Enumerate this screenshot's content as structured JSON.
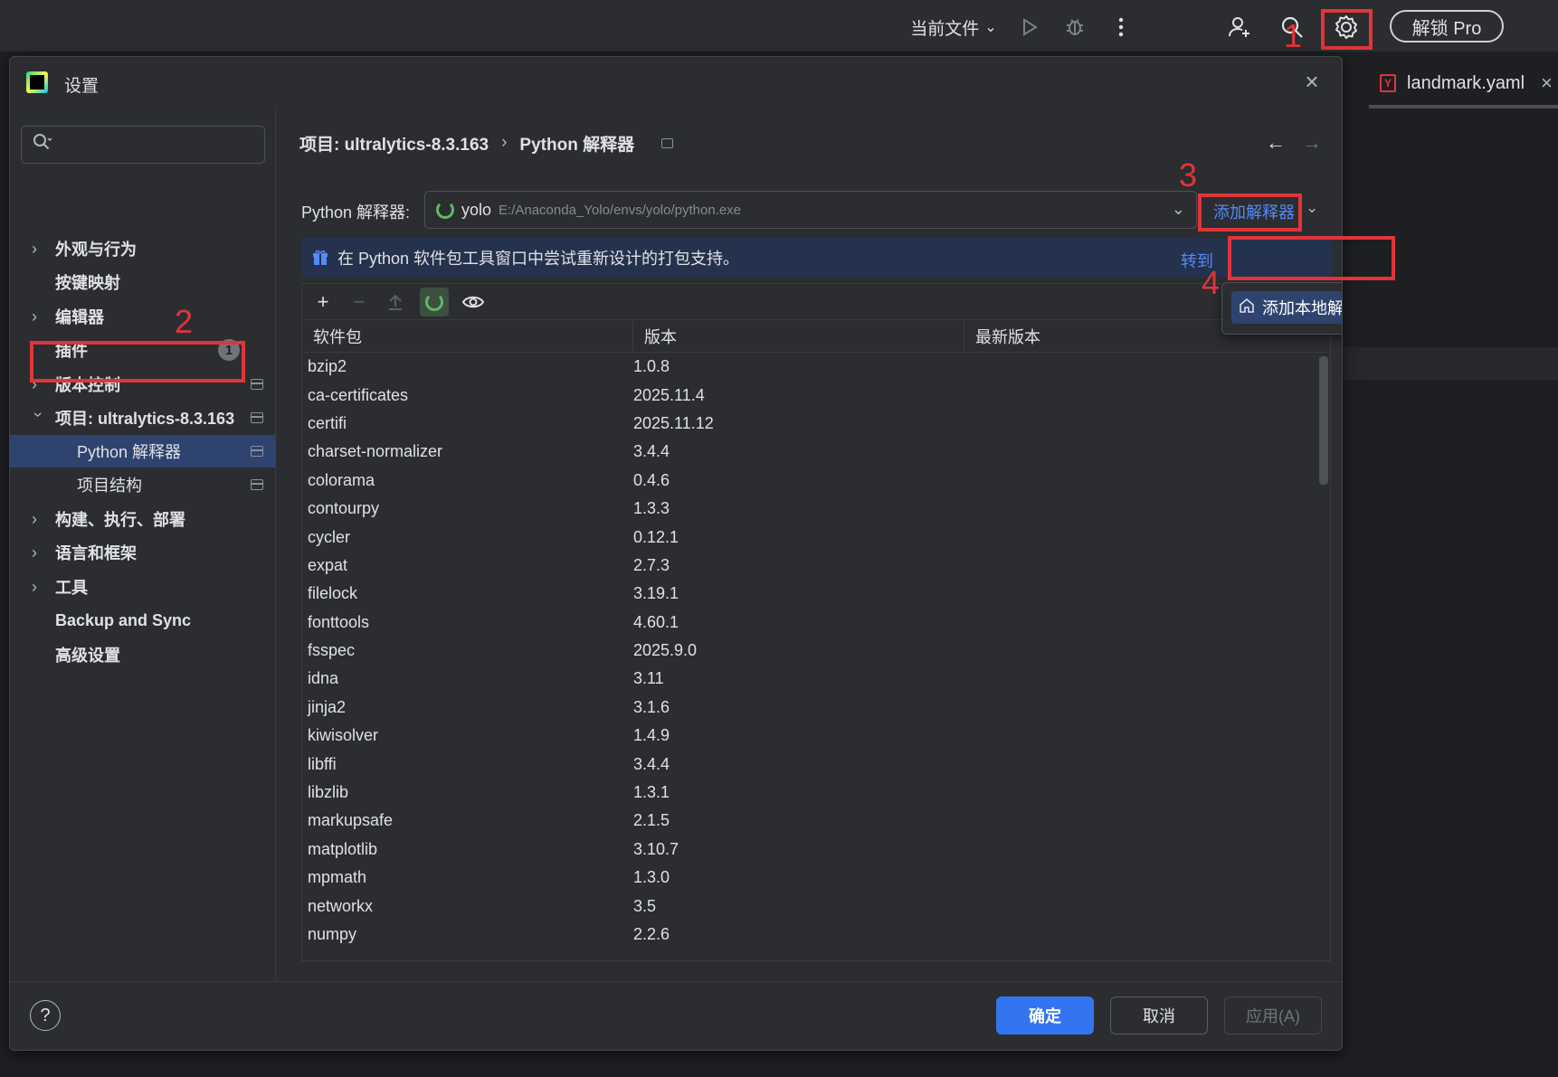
{
  "topbar": {
    "current_file_label": "当前文件",
    "pro_button_label": "解锁 Pro",
    "icons": [
      "run-icon",
      "debug-icon",
      "more-icon",
      "add-user-icon",
      "search-icon",
      "settings-icon"
    ]
  },
  "editor": {
    "tab_label": "landmark.yaml",
    "tab_icon_letter": "Y"
  },
  "annotations": [
    "1",
    "2",
    "3",
    "4"
  ],
  "dialog": {
    "title": "设置",
    "close_glyph": "×"
  },
  "sidebar": {
    "search_placeholder": "",
    "items": [
      {
        "label": "外观与行为",
        "expandable": true
      },
      {
        "label": "按键映射",
        "expandable": false
      },
      {
        "label": "编辑器",
        "expandable": true
      },
      {
        "label": "插件",
        "expandable": false,
        "badge": "1"
      },
      {
        "label": "版本控制",
        "expandable": true
      },
      {
        "label": "项目: ultralytics-8.3.163",
        "expandable": true,
        "expanded": true
      },
      {
        "label": "Python 解释器",
        "sub": true,
        "selected": true
      },
      {
        "label": "项目结构",
        "sub": true
      },
      {
        "label": "构建、执行、部署",
        "expandable": true
      },
      {
        "label": "语言和框架",
        "expandable": true
      },
      {
        "label": "工具",
        "expandable": true
      },
      {
        "label": "Backup and Sync",
        "expandable": false
      },
      {
        "label": "高级设置",
        "expandable": false
      }
    ]
  },
  "breadcrumb": {
    "project": "项目: ultralytics-8.3.163",
    "separator": "›",
    "page": "Python 解释器"
  },
  "interpreter": {
    "label": "Python 解释器:",
    "name": "yolo",
    "path": "E:/Anaconda_Yolo/envs/yolo/python.exe",
    "add_button": "添加解释器"
  },
  "popup": {
    "item_label": "添加本地解释器..."
  },
  "banner": {
    "text": "在 Python 软件包工具窗口中尝试重新设计的打包支持。",
    "link": "转到"
  },
  "packages": {
    "columns": [
      "软件包",
      "版本",
      "最新版本"
    ],
    "rows": [
      {
        "name": "bzip2",
        "version": "1.0.8",
        "latest": ""
      },
      {
        "name": "ca-certificates",
        "version": "2025.11.4",
        "latest": ""
      },
      {
        "name": "certifi",
        "version": "2025.11.12",
        "latest": ""
      },
      {
        "name": "charset-normalizer",
        "version": "3.4.4",
        "latest": ""
      },
      {
        "name": "colorama",
        "version": "0.4.6",
        "latest": ""
      },
      {
        "name": "contourpy",
        "version": "1.3.3",
        "latest": ""
      },
      {
        "name": "cycler",
        "version": "0.12.1",
        "latest": ""
      },
      {
        "name": "expat",
        "version": "2.7.3",
        "latest": ""
      },
      {
        "name": "filelock",
        "version": "3.19.1",
        "latest": ""
      },
      {
        "name": "fonttools",
        "version": "4.60.1",
        "latest": ""
      },
      {
        "name": "fsspec",
        "version": "2025.9.0",
        "latest": ""
      },
      {
        "name": "idna",
        "version": "3.11",
        "latest": ""
      },
      {
        "name": "jinja2",
        "version": "3.1.6",
        "latest": ""
      },
      {
        "name": "kiwisolver",
        "version": "1.4.9",
        "latest": ""
      },
      {
        "name": "libffi",
        "version": "3.4.4",
        "latest": ""
      },
      {
        "name": "libzlib",
        "version": "1.3.1",
        "latest": ""
      },
      {
        "name": "markupsafe",
        "version": "2.1.5",
        "latest": ""
      },
      {
        "name": "matplotlib",
        "version": "3.10.7",
        "latest": ""
      },
      {
        "name": "mpmath",
        "version": "1.3.0",
        "latest": ""
      },
      {
        "name": "networkx",
        "version": "3.5",
        "latest": ""
      },
      {
        "name": "numpy",
        "version": "2.2.6",
        "latest": ""
      }
    ]
  },
  "footer": {
    "help": "?",
    "ok": "确定",
    "cancel": "取消",
    "apply": "应用(A)"
  }
}
